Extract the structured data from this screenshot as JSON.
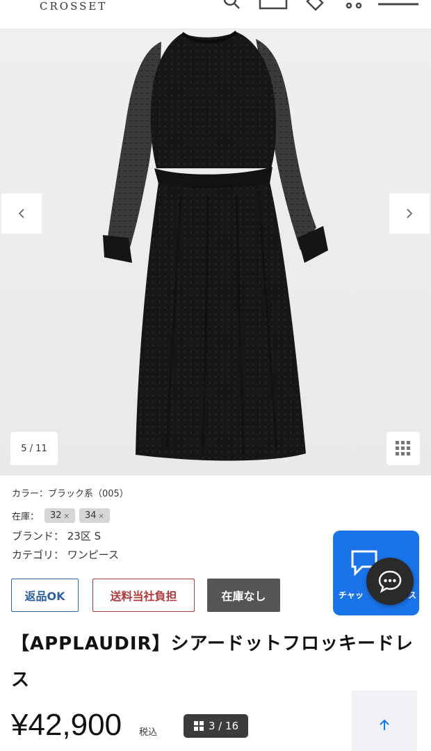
{
  "header": {
    "logo": "CROSSET",
    "icons": [
      "search-icon",
      "mail-icon",
      "tag-icon",
      "cart-icon",
      "menu-icon"
    ]
  },
  "gallery": {
    "counter": "5 / 11",
    "image": "black-sheer-dot-dress",
    "prev_icon": "chevron-left-icon",
    "next_icon": "chevron-right-icon",
    "grid_icon": "grid-icon"
  },
  "info": {
    "color": "カラー：ブラック系（005）",
    "stock_label": "在庫：",
    "sizes": [
      {
        "label": "32",
        "x": "×"
      },
      {
        "label": "34",
        "x": "×"
      }
    ],
    "brand": "ブランド： 23区 S",
    "category": "カテゴリ： ワンピース"
  },
  "tags": {
    "return": "返品OK",
    "shipping": "送料当社負担",
    "nostock": "在庫なし"
  },
  "chat": {
    "label": "チャッ",
    "suffix": "ス",
    "color": "#1a73e8"
  },
  "product": {
    "title": "【APPLAUDIR】シアードットフロッキードレス",
    "price": "¥42,900",
    "tax": "税込",
    "page_indicator": "3 / 16"
  }
}
